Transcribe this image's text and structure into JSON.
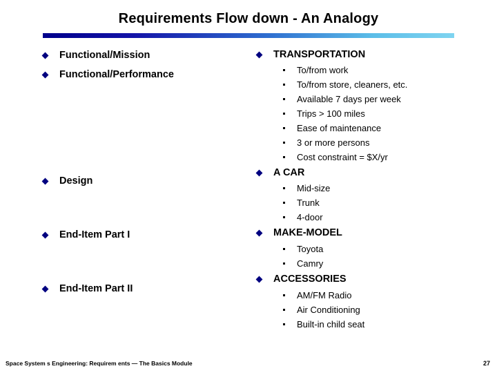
{
  "slide": {
    "title": "Requirements Flow down - An Analogy",
    "footer": "Space System s Engineering: Requirem ents — The Basics Module",
    "page_number": "27",
    "accent_color_start": "#00008B",
    "accent_color_end": "#7fd4f0",
    "bullet_color": "#000080"
  },
  "left_column": [
    {
      "label": "Functional/Mission"
    },
    {
      "label": "Functional/Performance"
    },
    {
      "label": "Design"
    },
    {
      "label": "End-Item Part I"
    },
    {
      "label": "End-Item Part II"
    }
  ],
  "right_column": [
    {
      "label": "TRANSPORTATION",
      "items": [
        "To/from work",
        "To/from store, cleaners, etc.",
        "Available 7 days per week",
        "Trips > 100 miles",
        "Ease of maintenance",
        "3 or more persons",
        "Cost constraint = $X/yr"
      ]
    },
    {
      "label": "A CAR",
      "items": [
        "Mid-size",
        "Trunk",
        "4-door"
      ]
    },
    {
      "label": "MAKE-MODEL",
      "items": [
        "Toyota",
        "Camry"
      ]
    },
    {
      "label": "ACCESSORIES",
      "items": [
        "AM/FM Radio",
        "Air Conditioning",
        "Built-in child seat"
      ]
    }
  ]
}
